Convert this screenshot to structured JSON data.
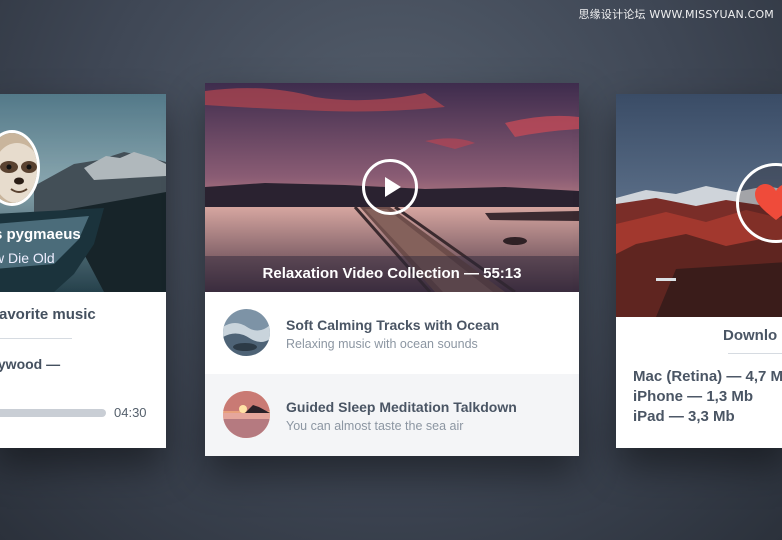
{
  "watermark": "思缘设计论坛 WWW.MISSYUAN.COM",
  "left_card": {
    "title": "s pygmaeus",
    "subtitle": "w Die Old",
    "favorite_label": "favorite music",
    "track_label": "lywood —",
    "time": "04:30",
    "progress": 0.02
  },
  "center_card": {
    "hero_caption": "Relaxation Video Collection — 55:13",
    "items": [
      {
        "title": "Soft Calming Tracks with Ocean",
        "subtitle": "Relaxing music with ocean sounds"
      },
      {
        "title": "Guided Sleep Meditation Talkdown",
        "subtitle": "You can almost taste the sea air"
      }
    ]
  },
  "right_card": {
    "download_label": "Downlo",
    "downloads": [
      {
        "label": "Mac (Retina) — 4,7 M"
      },
      {
        "label": "iPhone — 1,3 Mb"
      },
      {
        "label": "iPad — 3,3 Mb"
      }
    ]
  },
  "colors": {
    "accent_heart": "#ef4b3a",
    "text_dark": "#4a5564",
    "text_muted": "#8c96a2"
  },
  "icons": [
    "play-icon",
    "heart-icon",
    "sloth-avatar-icon"
  ]
}
